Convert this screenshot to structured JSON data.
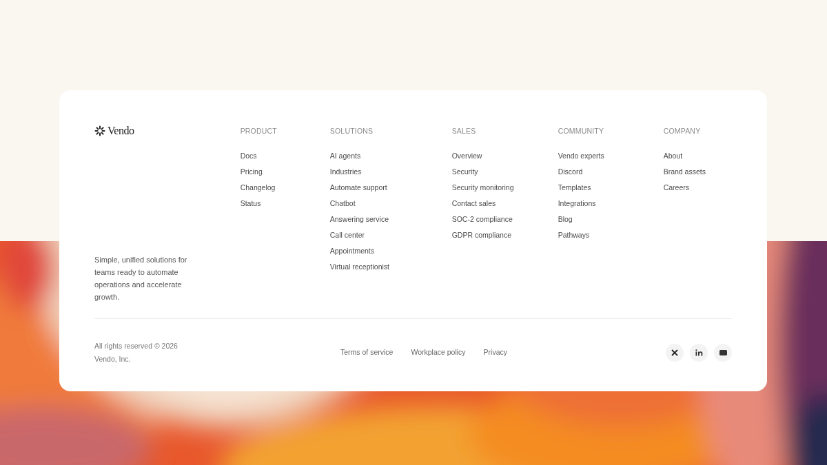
{
  "brand": {
    "name": "Vendo",
    "tagline": "Simple, unified solutions for teams ready to automate operations and accelerate growth."
  },
  "columns": [
    {
      "heading": "PRODUCT",
      "links": [
        "Docs",
        "Pricing",
        "Changelog",
        "Status"
      ]
    },
    {
      "heading": "SOLUTIONS",
      "links": [
        "AI agents",
        "Industries",
        "Automate support",
        "Chatbot",
        "Answering service",
        "Call center",
        "Appointments",
        "Virtual receptionist"
      ]
    },
    {
      "heading": "SALES",
      "links": [
        "Overview",
        "Security",
        "Security monitoring",
        "Contact sales",
        "SOC-2 compliance",
        "GDPR compliance"
      ]
    },
    {
      "heading": "COMMUNITY",
      "links": [
        "Vendo experts",
        "Discord",
        "Templates",
        "Integrations",
        "Blog",
        "Pathways"
      ]
    },
    {
      "heading": "COMPANY",
      "links": [
        "About",
        "Brand assets",
        "Careers"
      ]
    }
  ],
  "copyright": [
    "All rights reserved © 2026",
    "Vendo, Inc."
  ],
  "legal_links": [
    "Terms of service",
    "Workplace policy",
    "Privacy"
  ],
  "social": [
    {
      "kind": "x"
    },
    {
      "kind": "linkedin"
    },
    {
      "kind": "mail"
    }
  ]
}
